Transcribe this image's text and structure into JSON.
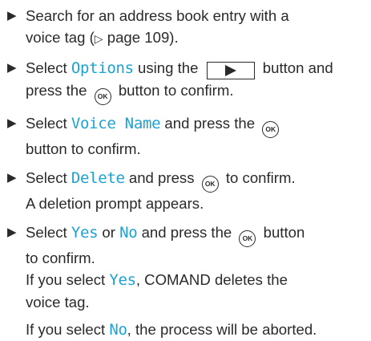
{
  "bullet_glyph": "▶",
  "steps": [
    {
      "line1": "Search for an address book entry with a",
      "line2_prefix": "voice tag (",
      "page_ref_icon": "▷",
      "line2_suffix": " page 109)."
    },
    {
      "pre": "Select ",
      "menu_item": "Options",
      "mid": " using the ",
      "button_icon": "right-arrow-icon",
      "post": " button and",
      "line2_pre": "press the ",
      "ok_label": "OK",
      "line2_post": " button to confirm."
    },
    {
      "pre": "Select ",
      "menu_item": "Voice Name",
      "mid": " and press the ",
      "ok_label": "OK",
      "line2": "button to confirm."
    },
    {
      "pre": "Select ",
      "menu_item": "Delete",
      "mid": " and press ",
      "ok_label": "OK",
      "post": " to confirm.",
      "result": "A deletion prompt appears."
    },
    {
      "pre": "Select ",
      "opt_yes": "Yes",
      "or": " or ",
      "opt_no": "No",
      "mid": " and press the ",
      "ok_label": "OK",
      "post": " button",
      "line2": "to confirm.",
      "result_yes_pre": "If you select ",
      "result_yes_opt": "Yes",
      "result_yes_post": ", COMAND deletes the",
      "result_yes_line2": "voice tag.",
      "result_no_pre": "If you select ",
      "result_no_opt": "No",
      "result_no_post": ", the process will be aborted."
    }
  ],
  "colors": {
    "text": "#2a2a2a",
    "accent": "#1ca2d3"
  }
}
